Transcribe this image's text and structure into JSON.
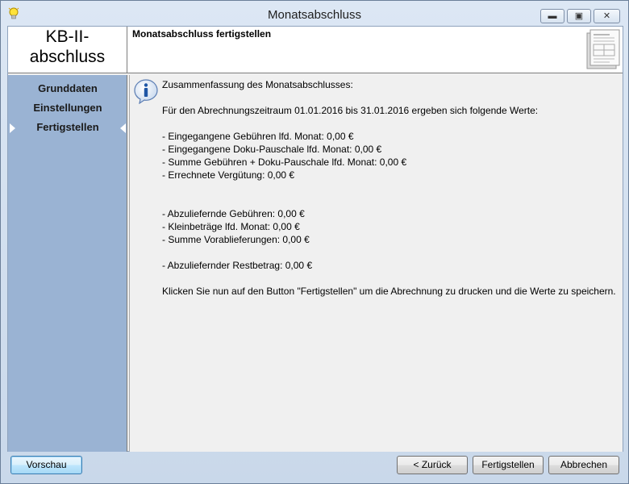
{
  "window": {
    "title": "Monatsabschluss"
  },
  "header": {
    "logo_line1": "KB-II-",
    "logo_line2": "abschluss",
    "title": "Monatsabschluss fertigstellen"
  },
  "sidebar": {
    "items": [
      {
        "label": "Grunddaten",
        "active": false
      },
      {
        "label": "Einstellungen",
        "active": false
      },
      {
        "label": "Fertigstellen",
        "active": true
      }
    ]
  },
  "summary": {
    "heading": "Zusammenfassung des Monatsabschlusses:",
    "period_text": "Für den Abrechnungszeitraum 01.01.2016 bis 31.01.2016 ergeben sich folgende Werte:",
    "group1": [
      "- Eingegangene Gebühren lfd. Monat: 0,00 €",
      "- Eingegangene Doku-Pauschale lfd. Monat: 0,00 €",
      "- Summe Gebühren + Doku-Pauschale lfd. Monat: 0,00 €",
      "- Errechnete Vergütung: 0,00 €"
    ],
    "group2": [
      "- Abzuliefernde Gebühren: 0,00 €",
      "- Kleinbeträge lfd. Monat: 0,00 €",
      "- Summe Vorablieferungen: 0,00 €"
    ],
    "group3": [
      "- Abzuliefernder Restbetrag: 0,00 €"
    ],
    "instruction": "Klicken Sie nun auf den Button \"Fertigstellen\" um die Abrechnung zu drucken und die Werte zu speichern."
  },
  "footer": {
    "preview_label": "Vorschau",
    "back_label": "< Zurück",
    "finish_label": "Fertigstellen",
    "cancel_label": "Abbrechen"
  },
  "icons": {
    "app": "lightbulb-icon",
    "info": "info-icon",
    "document": "document-icon"
  },
  "colors": {
    "sidebar_bg": "#9ab3d3",
    "content_bg": "#f0f0f0",
    "info_blue": "#2a5fa8"
  }
}
